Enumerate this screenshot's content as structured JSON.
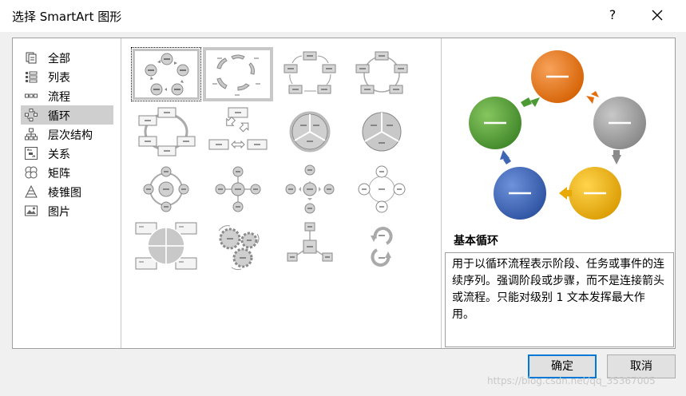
{
  "dialog": {
    "title": "选择 SmartArt 图形",
    "help_label": "?",
    "close_icon": "close-icon"
  },
  "categories": [
    {
      "label": "全部",
      "icon": "all-icon",
      "selected": false
    },
    {
      "label": "列表",
      "icon": "list-icon",
      "selected": false
    },
    {
      "label": "流程",
      "icon": "process-icon",
      "selected": false
    },
    {
      "label": "循环",
      "icon": "cycle-icon",
      "selected": true
    },
    {
      "label": "层次结构",
      "icon": "hierarchy-icon",
      "selected": false
    },
    {
      "label": "关系",
      "icon": "relationship-icon",
      "selected": false
    },
    {
      "label": "矩阵",
      "icon": "matrix-icon",
      "selected": false
    },
    {
      "label": "棱锥图",
      "icon": "pyramid-icon",
      "selected": false
    },
    {
      "label": "图片",
      "icon": "picture-icon",
      "selected": false
    }
  ],
  "gallery": {
    "selected_index": 0,
    "hover_index": 1,
    "count": 16
  },
  "preview": {
    "title": "基本循环",
    "description": "用于以循环流程表示阶段、任务或事件的连续序列。强调阶段或步骤，而不是连接箭头或流程。只能对级别 1 文本发挥最大作用。",
    "colors": [
      "#e46c0a",
      "#9b9b9b",
      "#e8a900",
      "#3e66b5",
      "#4c9a34"
    ]
  },
  "buttons": {
    "ok": "确定",
    "cancel": "取消"
  },
  "watermark": "https://blog.csdn.net/qq_35367005"
}
